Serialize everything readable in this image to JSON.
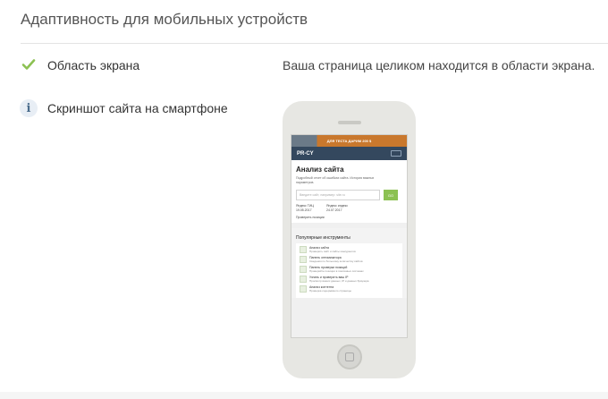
{
  "section": {
    "title": "Адаптивность для мобильных устройств"
  },
  "rows": [
    {
      "icon": "check-icon",
      "label": "Область экрана",
      "value": "Ваша страница целиком находится в области экрана."
    },
    {
      "icon": "info-icon",
      "icon_glyph": "i",
      "label": "Скриншот сайта на смартфоне"
    }
  ],
  "screenshot": {
    "ad_text": "ДЛЯ ТЕСТА ДАРИМ 200 $",
    "logo": "PR-CY",
    "hero_title": "Анализ сайта",
    "hero_desc": "Подробный отчет об ошибках сайта. История важных параметров.",
    "input_placeholder": "Введите сайт, например: site.ru",
    "go_label": "GO",
    "stat_1_label": "Яндекс ТИЦ",
    "stat_1_value": "19.05.2017",
    "stat_2_label": "Яндекс индекс",
    "stat_2_value": "24.07.2017",
    "position_link": "Проверить позиции",
    "tools_title": "Популярные инструменты",
    "tools": [
      {
        "name": "Анализ сайта",
        "desc": "Проверить сайт и сайты конкурентов"
      },
      {
        "name": "Панель оптимизатора",
        "desc": "Сведения по большому количеству сайтов"
      },
      {
        "name": "Панель проверки позиций",
        "desc": "Проверяйте позиции в поисковых системах"
      },
      {
        "name": "Узнать и проверить ваш IP",
        "desc": "Просмотр ваших данных, IP и данных браузера"
      },
      {
        "name": "Анализ контента",
        "desc": "Проверка содержимого страницы"
      }
    ]
  },
  "colors": {
    "check": "#8cc152",
    "header": "#34485e",
    "accent": "#c9782d"
  }
}
